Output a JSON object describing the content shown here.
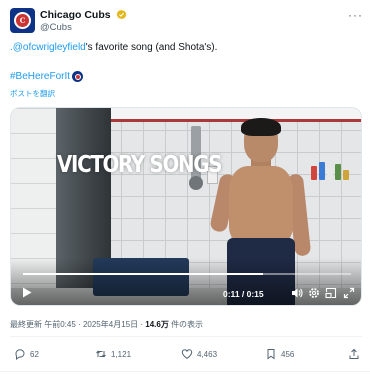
{
  "author": {
    "display_name": "Chicago Cubs",
    "handle": "@Cubs",
    "avatar_letter": "C",
    "avatar_colors": {
      "outer": "#0e3386",
      "inner": "#cc3433"
    },
    "verified_badge": "gold-check-badge"
  },
  "tweet": {
    "mention": ".@ofcwrigleyfield",
    "text_after_mention": "'s favorite song (and Shota's).",
    "hashtag": "#BeHereForIt",
    "hashtag_emoji": "cubs-logo-emoji",
    "translate_label": "ポストを翻訳"
  },
  "video": {
    "overlay_title": "VICTORY SONGS",
    "current_time": "0:11",
    "duration": "0:15",
    "timecode": "0:11 / 0:15",
    "progress_fraction": 0.733,
    "control_icons": [
      "play-icon",
      "volume-icon",
      "settings-icon",
      "picture-in-picture-icon",
      "fullscreen-icon"
    ]
  },
  "meta": {
    "edited_label": "最終更新",
    "time": "午前0:45",
    "separator": "·",
    "date": "2025年4月15日",
    "views_count": "14.6万",
    "views_label": "件の表示"
  },
  "actions": {
    "replies": "62",
    "reposts": "1,121",
    "likes": "4,463",
    "bookmarks": "456"
  },
  "colors": {
    "link": "#1d9bf0",
    "text": "#0f1419",
    "secondary": "#536471",
    "verified_gold": "#e2b719"
  }
}
